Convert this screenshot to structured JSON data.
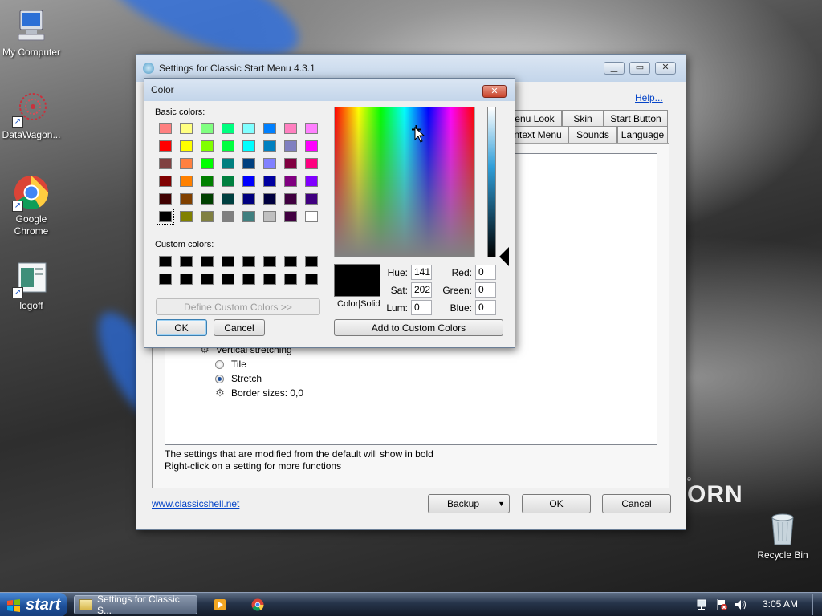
{
  "desktop": {
    "icons": [
      {
        "label": "My Computer"
      },
      {
        "label": "DataWagon..."
      },
      {
        "label": "Google Chrome"
      },
      {
        "label": "logoff"
      },
      {
        "label": "Recycle Bin"
      }
    ],
    "wallpaper_text": "ORN",
    "wallpaper_small": "e"
  },
  "settings_window": {
    "title": "Settings for Classic Start Menu 4.3.1",
    "help_link": "Help...",
    "tabs_row1": [
      "enu Look",
      "Skin",
      "Start Button"
    ],
    "tabs_row2": [
      "ntext Menu",
      "Sounds",
      "Language"
    ],
    "tree_items": [
      {
        "label": "Vertical stretching",
        "kind": "gear"
      },
      {
        "label": "Tile",
        "kind": "radio",
        "checked": false
      },
      {
        "label": "Stretch",
        "kind": "radio",
        "checked": true
      },
      {
        "label": "Border sizes: 0,0",
        "kind": "gear"
      }
    ],
    "hint_line1": "The settings that are modified from the default will show in bold",
    "hint_line2": "Right-click on a setting for more functions",
    "website_link": "www.classicshell.net",
    "backup_label": "Backup",
    "ok_label": "OK",
    "cancel_label": "Cancel"
  },
  "color_dialog": {
    "title": "Color",
    "basic_colors_label": "Basic colors:",
    "custom_colors_label": "Custom colors:",
    "basic_colors": [
      "#ff8080",
      "#ffff80",
      "#80ff80",
      "#00ff80",
      "#80ffff",
      "#0080ff",
      "#ff80c0",
      "#ff80ff",
      "#ff0000",
      "#ffff00",
      "#80ff00",
      "#00ff40",
      "#00ffff",
      "#0080c0",
      "#8080c0",
      "#ff00ff",
      "#804040",
      "#ff8040",
      "#00ff00",
      "#008080",
      "#004080",
      "#8080ff",
      "#800040",
      "#ff0080",
      "#800000",
      "#ff8000",
      "#008000",
      "#008040",
      "#0000ff",
      "#0000a0",
      "#800080",
      "#8000ff",
      "#400000",
      "#804000",
      "#004000",
      "#004040",
      "#000080",
      "#000040",
      "#400040",
      "#400080",
      "#000000",
      "#808000",
      "#808040",
      "#808080",
      "#408080",
      "#c0c0c0",
      "#400040",
      "#ffffff"
    ],
    "selected_basic_index": 40,
    "custom_colors": [
      "#000000",
      "#000000",
      "#000000",
      "#000000",
      "#000000",
      "#000000",
      "#000000",
      "#000000",
      "#000000",
      "#000000",
      "#000000",
      "#000000",
      "#000000",
      "#000000",
      "#000000",
      "#000000"
    ],
    "define_custom_label": "Define Custom Colors >>",
    "ok_label": "OK",
    "cancel_label": "Cancel",
    "color_solid_label": "Color|Solid",
    "fields": {
      "hue_label": "Hue:",
      "hue": "141",
      "sat_label": "Sat:",
      "sat": "202",
      "lum_label": "Lum:",
      "lum": "0",
      "red_label": "Red:",
      "red": "0",
      "green_label": "Green:",
      "green": "0",
      "blue_label": "Blue:",
      "blue": "0"
    },
    "add_custom_label": "Add to Custom Colors",
    "preview_color": "#000000"
  },
  "taskbar": {
    "start_label": "start",
    "task_label": "Settings for Classic S...",
    "clock": "3:05 AM"
  }
}
